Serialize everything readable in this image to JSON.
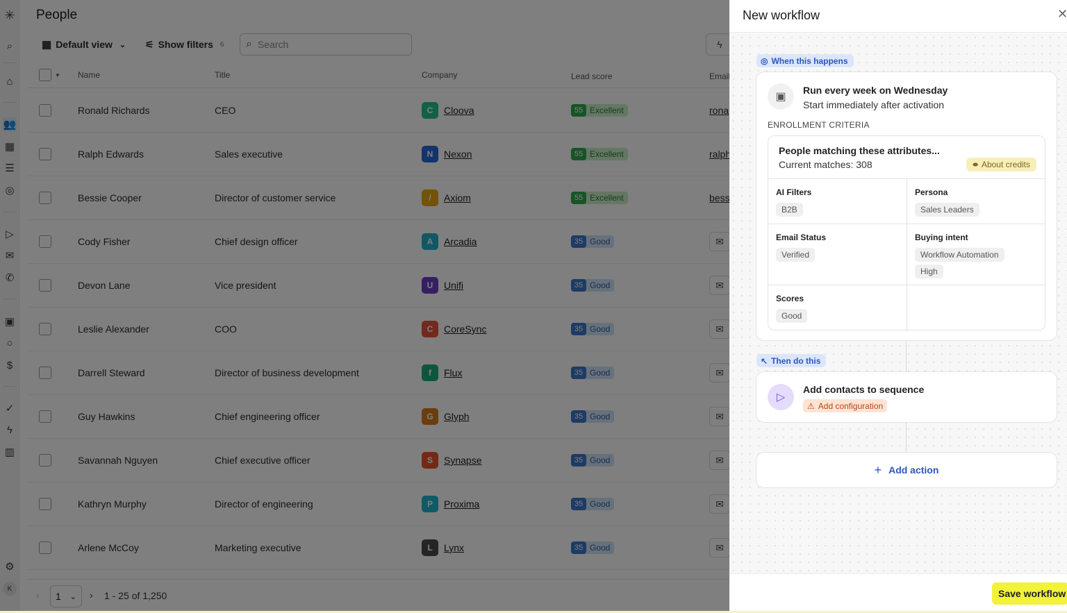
{
  "app": {
    "page_title": "People",
    "rail_user_initial": "K"
  },
  "toolbar": {
    "view_label": "Default view",
    "filters_label": "Show filters",
    "filters_count": "6",
    "search_placeholder": "Search"
  },
  "table": {
    "columns": [
      "Name",
      "Title",
      "Company",
      "Lead score",
      "Email"
    ],
    "rows": [
      {
        "name": "Ronald Richards",
        "title": "CEO",
        "company": "Cloova",
        "logo_color": "#27c08a",
        "logo_glyph": "C",
        "score_num": "55",
        "score_label": "Excellent",
        "score_kind": "ex",
        "email": "rona"
      },
      {
        "name": "Ralph Edwards",
        "title": "Sales executive",
        "company": "Nexon",
        "logo_color": "#2466d8",
        "logo_glyph": "N",
        "score_num": "55",
        "score_label": "Excellent",
        "score_kind": "ex",
        "email": "ralph"
      },
      {
        "name": "Bessie Cooper",
        "title": "Director of customer service",
        "company": "Axiom",
        "logo_color": "#e7a514",
        "logo_glyph": "/",
        "score_num": "55",
        "score_label": "Excellent",
        "score_kind": "ex",
        "email": "bess"
      },
      {
        "name": "Cody Fisher",
        "title": "Chief design officer",
        "company": "Arcadia",
        "logo_color": "#22b0c8",
        "logo_glyph": "A",
        "score_num": "35",
        "score_label": "Good",
        "score_kind": "gd",
        "email": ""
      },
      {
        "name": "Devon Lane",
        "title": "Vice president",
        "company": "Unifi",
        "logo_color": "#6a3fc7",
        "logo_glyph": "U",
        "score_num": "35",
        "score_label": "Good",
        "score_kind": "gd",
        "email": ""
      },
      {
        "name": "Leslie Alexander",
        "title": "COO",
        "company": "CoreSync",
        "logo_color": "#e2543a",
        "logo_glyph": "C",
        "score_num": "35",
        "score_label": "Good",
        "score_kind": "gd",
        "email": ""
      },
      {
        "name": "Darrell Steward",
        "title": "Director of business development",
        "company": "Flux",
        "logo_color": "#1faa7a",
        "logo_glyph": "f",
        "score_num": "35",
        "score_label": "Good",
        "score_kind": "gd",
        "email": ""
      },
      {
        "name": "Guy Hawkins",
        "title": "Chief engineering officer",
        "company": "Glyph",
        "logo_color": "#d47a1e",
        "logo_glyph": "G",
        "score_num": "35",
        "score_label": "Good",
        "score_kind": "gd",
        "email": ""
      },
      {
        "name": "Savannah Nguyen",
        "title": "Chief executive officer",
        "company": "Synapse",
        "logo_color": "#e4542e",
        "logo_glyph": "S",
        "score_num": "35",
        "score_label": "Good",
        "score_kind": "gd",
        "email": ""
      },
      {
        "name": "Kathryn Murphy",
        "title": "Director of engineering",
        "company": "Proxima",
        "logo_color": "#1fb5c9",
        "logo_glyph": "P",
        "score_num": "35",
        "score_label": "Good",
        "score_kind": "gd",
        "email": ""
      },
      {
        "name": "Arlene McCoy",
        "title": "Marketing executive",
        "company": "Lynx",
        "logo_color": "#4a4a4a",
        "logo_glyph": "L",
        "score_num": "35",
        "score_label": "Good",
        "score_kind": "gd",
        "email": ""
      }
    ]
  },
  "pagination": {
    "page": "1",
    "range_text": "1 - 25 of 1,250"
  },
  "workflow": {
    "title": "New workflow",
    "trigger_tag": "When this happens",
    "trigger_title": "Run every week on Wednesday",
    "trigger_sub": "Start immediately after activation",
    "enrollment_caption": "ENROLLMENT CRITERIA",
    "criteria_title": "People matching these attributes...",
    "criteria_matches": "Current matches: 308",
    "credits_label": "About credits",
    "filters": {
      "ai_label": "AI Filters",
      "ai_values": [
        "B2B"
      ],
      "persona_label": "Persona",
      "persona_values": [
        "Sales Leaders"
      ],
      "email_status_label": "Email Status",
      "email_status_values": [
        "Verified"
      ],
      "buying_intent_label": "Buying intent",
      "buying_intent_values": [
        "Workflow Automation",
        "High"
      ],
      "scores_label": "Scores",
      "scores_values": [
        "Good"
      ]
    },
    "action_tag": "Then do this",
    "action_title": "Add contacts to sequence",
    "action_warning": "Add configuration",
    "add_action_label": "Add action",
    "save_label": "Save workflow"
  },
  "colors": {
    "accent_blue": "#2d57b8",
    "save_yellow": "#f2f23a",
    "excellent_green": "#2fa84a",
    "good_blue": "#3a76c8"
  }
}
